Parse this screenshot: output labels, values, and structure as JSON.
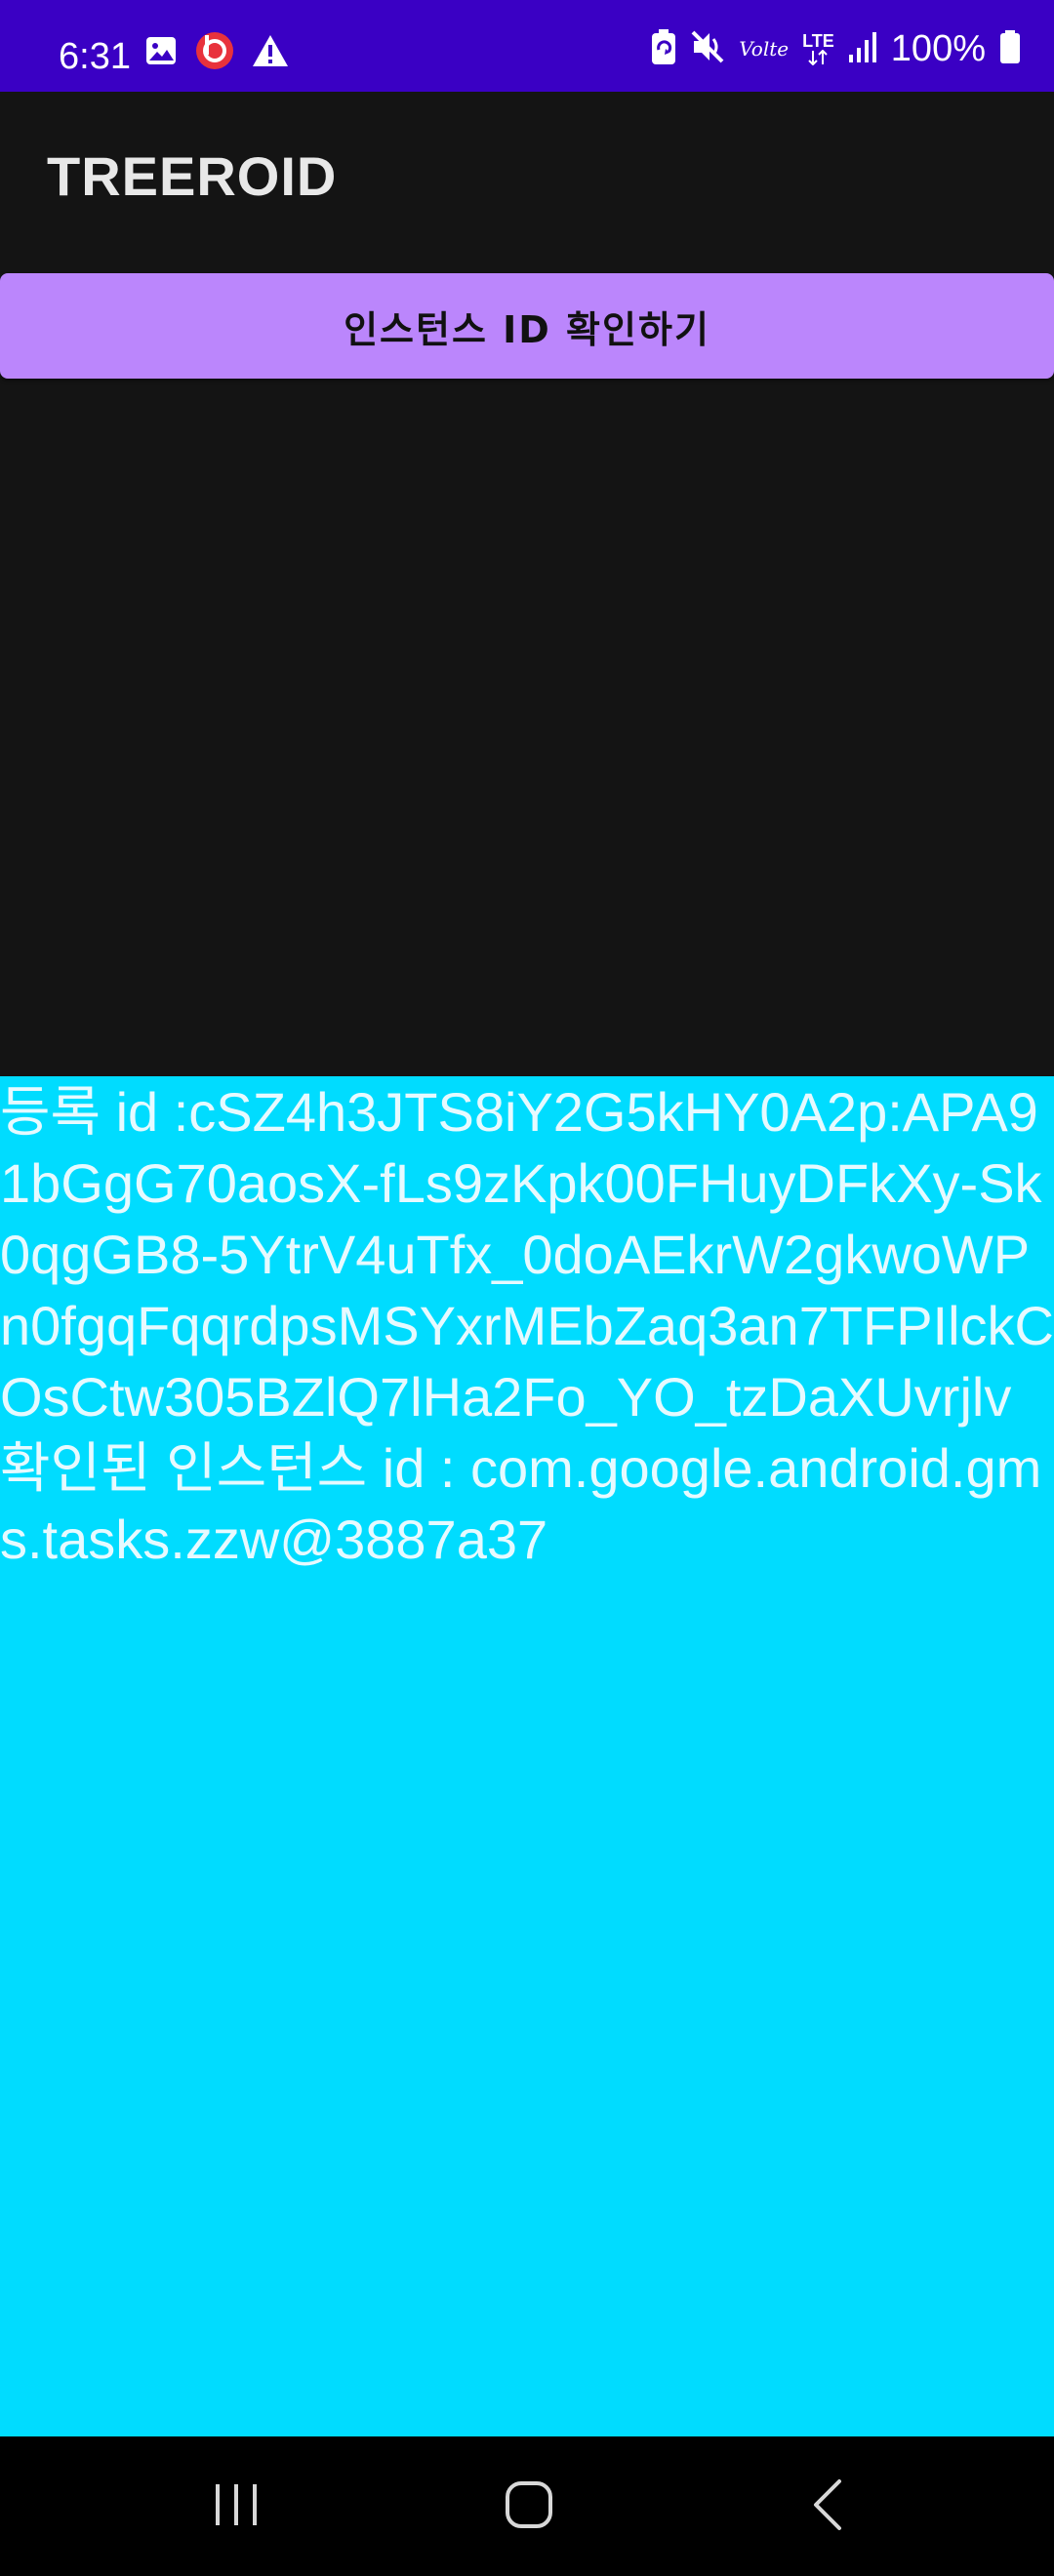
{
  "status_bar": {
    "time": "6:31",
    "battery": "100%",
    "network": "LTE",
    "volte": "Volte",
    "bg_color": "#3a00c4"
  },
  "app_bar": {
    "title": "TREEROID"
  },
  "button": {
    "label": "인스턴스 ID 확인하기",
    "color": "#bb86fc"
  },
  "result": {
    "registration_line": "등록 id :cSZ4h3JTS8iY2G5kHY0A2p:APA91bGgG70aosX-fLs9zKpk00FHuyDFkXy-Sk0qgGB8-5YtrV4uTfx_0doAEkrW2gkwoWPn0fgqFqqrdpsMSYxrMEbZaq3an7TFPIlckCOsCtw305BZlQ7lHa2Fo_YO_tzDaXUvrjlv",
    "instance_line": "확인된 인스턴스 id : com.google.android.gms.tasks.zzw@3887a37",
    "panel_color": "#00dcff"
  },
  "icons": {
    "status_left": [
      "image-icon",
      "beats-icon",
      "warning-icon"
    ],
    "status_right": [
      "battery-saver-icon",
      "mute-icon",
      "volte-icon",
      "lte-icon",
      "signal-icon",
      "battery-icon"
    ],
    "nav": [
      "recent-apps-icon",
      "home-icon",
      "back-icon"
    ]
  }
}
